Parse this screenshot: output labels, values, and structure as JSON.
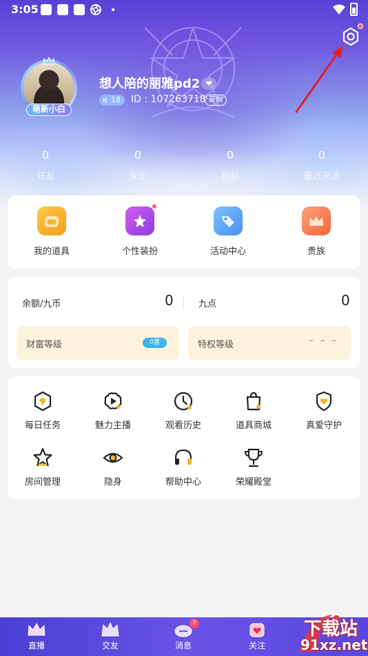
{
  "status_bar": {
    "time": "3:05"
  },
  "profile": {
    "username": "想人陪的丽雅pd2",
    "level": "18",
    "user_id": "ID : 107263718",
    "copy_label": "复制",
    "avatar_badge": "萌新小白"
  },
  "stats": [
    {
      "value": "0",
      "label": "好友"
    },
    {
      "value": "0",
      "label": "关注"
    },
    {
      "value": "0",
      "label": "粉丝"
    },
    {
      "value": "0",
      "label": "最近来访"
    }
  ],
  "quick_actions": [
    {
      "label": "我的道具",
      "icon": "bread-box-icon",
      "color": "#f7b23b"
    },
    {
      "label": "个性装扮",
      "icon": "star-sparkle-icon",
      "color": "#b34be8",
      "has_dot": true
    },
    {
      "label": "活动中心",
      "icon": "ticket-tag-icon",
      "color": "#5aa8f5"
    },
    {
      "label": "贵族",
      "icon": "crown-icon",
      "color": "#f5825a"
    }
  ],
  "wallet": {
    "balance_label": "余额/九币",
    "balance_value": "0",
    "points_label": "九点",
    "points_value": "0",
    "wealth_label": "财富等级",
    "wealth_tag": "0富",
    "privilege_label": "特权等级",
    "privilege_value": "– – –"
  },
  "functions": [
    {
      "label": "每日任务",
      "icon": "daily-task-icon"
    },
    {
      "label": "魅力主播",
      "icon": "charm-anchor-icon"
    },
    {
      "label": "观看历史",
      "icon": "clock-icon"
    },
    {
      "label": "道具商城",
      "icon": "shopping-bag-icon"
    },
    {
      "label": "真爱守护",
      "icon": "heart-shield-icon"
    },
    {
      "label": "房间管理",
      "icon": "star-outline-icon"
    },
    {
      "label": "隐身",
      "icon": "eye-icon"
    },
    {
      "label": "帮助中心",
      "icon": "headset-icon"
    },
    {
      "label": "荣耀殿堂",
      "icon": "trophy-icon"
    }
  ],
  "tabs": [
    {
      "label": "直播",
      "icon": "live-icon"
    },
    {
      "label": "交友",
      "icon": "friends-icon"
    },
    {
      "label": "消息",
      "icon": "message-icon",
      "badge": "7"
    },
    {
      "label": "关注",
      "icon": "follow-icon"
    }
  ],
  "watermark": {
    "line1": "下载站",
    "line2": "91xz.net"
  },
  "colors": {
    "accent": "#5a47de",
    "dot_red": "#ff5a7a",
    "wealth_tag": "#3bb6ef",
    "level_box": "#fdf3da"
  }
}
